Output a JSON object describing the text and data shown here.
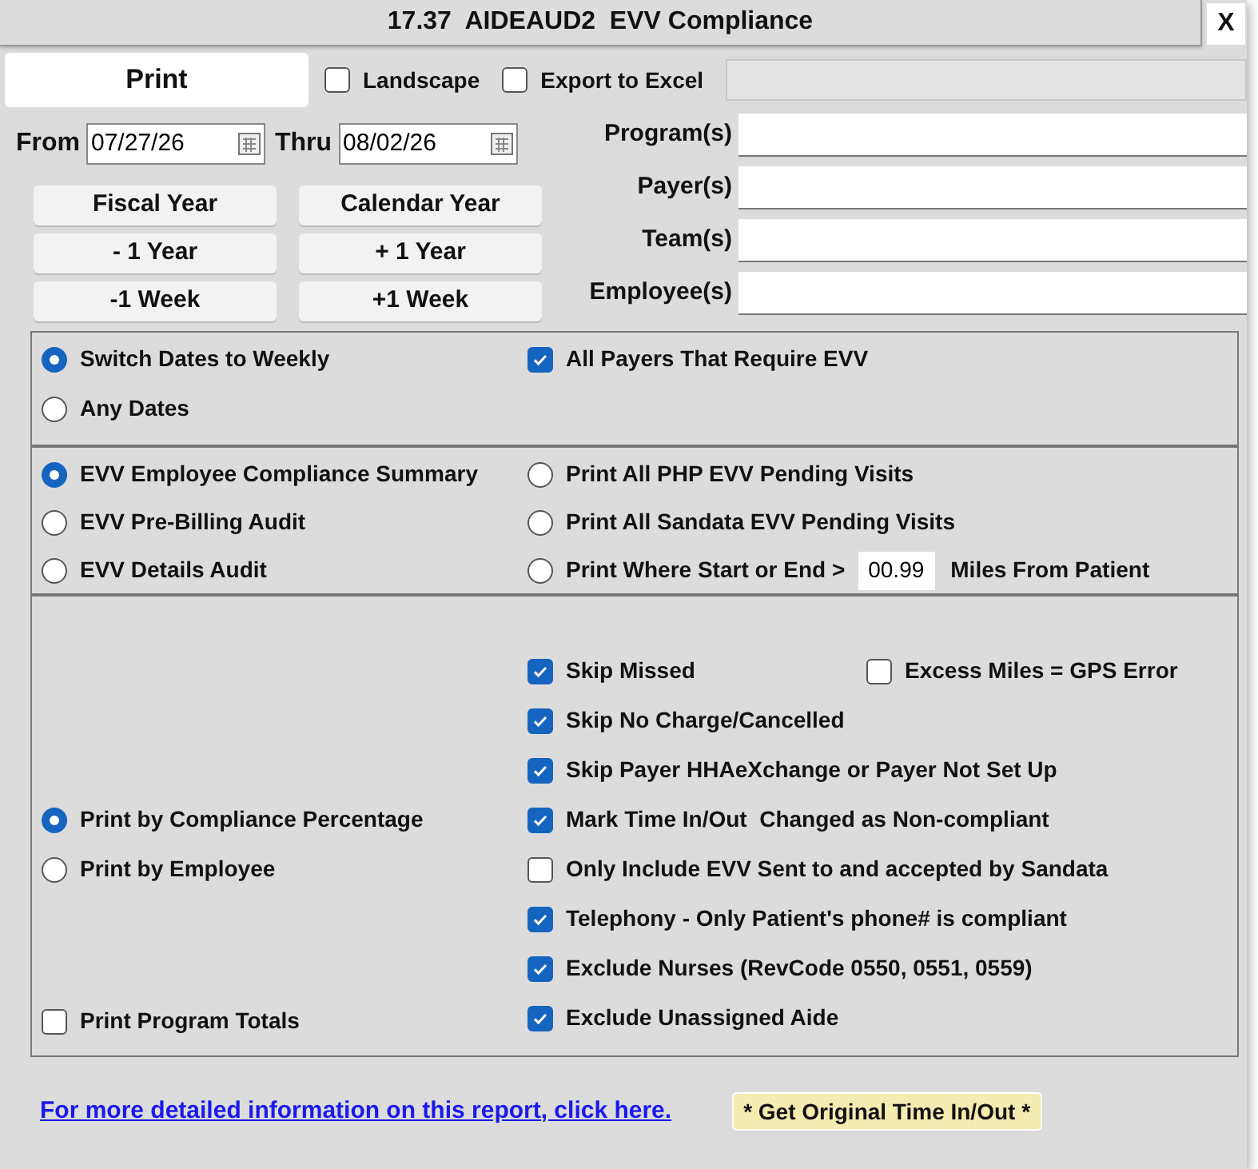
{
  "window": {
    "title": "17.37  AIDEAUD2  EVV Compliance",
    "close": "X"
  },
  "toolbar": {
    "print": "Print",
    "options": [
      {
        "label": "Landscape",
        "checked": false
      },
      {
        "label": "Export to Excel",
        "checked": false
      }
    ]
  },
  "dates": {
    "from_label": "From",
    "from": "07/27/26",
    "thru_label": "Thru",
    "thru": "08/02/26"
  },
  "date_buttons": [
    "Fiscal Year",
    "Calendar Year",
    "- 1 Year",
    "+ 1 Year",
    "-1 Week",
    "+1 Week"
  ],
  "filters": [
    {
      "label": "Program(s)"
    },
    {
      "label": "Payer(s)"
    },
    {
      "label": "Team(s)"
    },
    {
      "label": "Employee(s)"
    }
  ],
  "date_mode": [
    {
      "label": "Switch Dates to Weekly",
      "selected": true
    },
    {
      "label": "Any Dates",
      "selected": false
    }
  ],
  "all_payers": {
    "label": "All Payers That Require EVV",
    "checked": true
  },
  "reports": [
    {
      "kind": "plain",
      "label": "EVV Employee Compliance Summary",
      "selected": true
    },
    {
      "kind": "plain",
      "label": "EVV Pre-Billing Audit",
      "selected": false
    },
    {
      "kind": "plain",
      "label": "EVV Details Audit",
      "selected": false
    },
    {
      "kind": "plain",
      "label": "Print All PHP EVV Pending Visits",
      "selected": false
    },
    {
      "kind": "plain",
      "label": "Print All Sandata EVV Pending Visits",
      "selected": false
    },
    {
      "kind": "miles",
      "label": "Print Where Start or End >",
      "value": "00.99",
      "suffix": "Miles From Patient",
      "selected": false
    }
  ],
  "print_by": [
    {
      "label": "Print by Compliance Percentage",
      "selected": true
    },
    {
      "label": "Print by Employee",
      "selected": false
    }
  ],
  "program_totals": {
    "label": "Print Program Totals",
    "checked": false
  },
  "excess_miles": {
    "label": "Excess Miles = GPS Error",
    "checked": false
  },
  "skip_options": [
    {
      "label": "Skip Missed",
      "checked": true
    },
    {
      "label": "Skip No Charge/Cancelled",
      "checked": true
    },
    {
      "label": "Skip Payer HHAeXchange or Payer Not Set Up",
      "checked": true
    },
    {
      "label": "Mark Time In/Out  Changed as Non-compliant",
      "checked": true
    },
    {
      "label": "Only Include EVV Sent to and accepted by Sandata",
      "checked": false
    },
    {
      "label": "Telephony - Only Patient's phone# is compliant",
      "checked": true
    },
    {
      "label": "Exclude Nurses (RevCode 0550, 0551, 0559)",
      "checked": true
    },
    {
      "label": "Exclude Unassigned Aide",
      "checked": true
    }
  ],
  "footer": {
    "link": "For more detailed information on this report, click here.",
    "button": "* Get Original Time In/Out *"
  }
}
